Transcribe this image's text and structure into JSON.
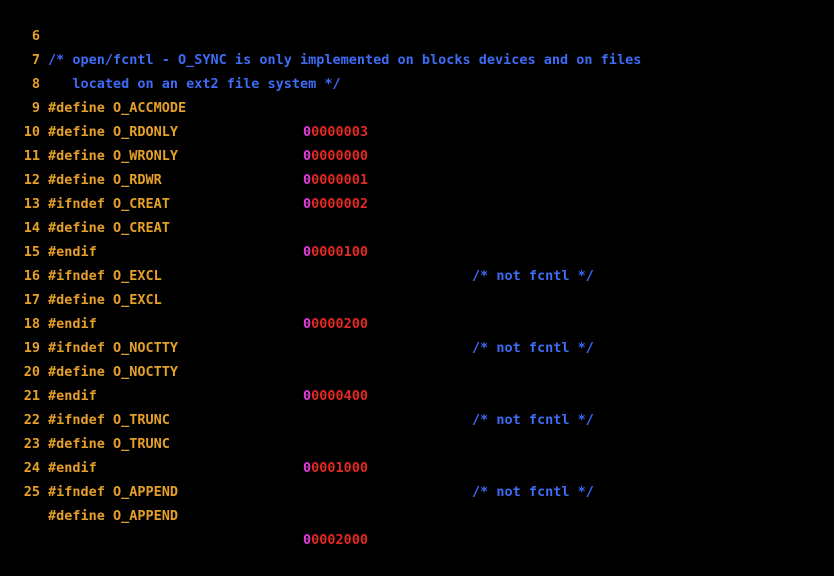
{
  "colors": {
    "background": "#000000",
    "line_number": "#e5a02a",
    "preprocessor": "#e5a02a",
    "comment": "#3f6bf5",
    "octal_prefix": "#e43ae0",
    "number": "#e02a22"
  },
  "lines": [
    {
      "num": "6",
      "text": "/* open/fcntl - O_SYNC is only implemented on blocks devices and on files",
      "kind": "comment"
    },
    {
      "num": "7",
      "text": "   located on an ext2 file system */",
      "kind": "comment"
    },
    {
      "num": "8",
      "text": "#define O_ACCMODE",
      "prefix": "0",
      "value": "0000003",
      "kind": "define"
    },
    {
      "num": "9",
      "text": "#define O_RDONLY",
      "prefix": "0",
      "value": "0000000",
      "kind": "define"
    },
    {
      "num": "10",
      "text": "#define O_WRONLY",
      "prefix": "0",
      "value": "0000001",
      "kind": "define"
    },
    {
      "num": "11",
      "text": "#define O_RDWR",
      "prefix": "0",
      "value": "0000002",
      "kind": "define"
    },
    {
      "num": "12",
      "text": "#ifndef O_CREAT",
      "kind": "pp"
    },
    {
      "num": "13",
      "text": "#define O_CREAT",
      "prefix": "0",
      "value": "0000100",
      "comment": "/* not fcntl */",
      "kind": "define"
    },
    {
      "num": "14",
      "text": "#endif",
      "kind": "pp"
    },
    {
      "num": "15",
      "text": "#ifndef O_EXCL",
      "kind": "pp"
    },
    {
      "num": "16",
      "text": "#define O_EXCL",
      "prefix": "0",
      "value": "0000200",
      "comment": "/* not fcntl */",
      "kind": "define"
    },
    {
      "num": "17",
      "text": "#endif",
      "kind": "pp"
    },
    {
      "num": "18",
      "text": "#ifndef O_NOCTTY",
      "kind": "pp"
    },
    {
      "num": "19",
      "text": "#define O_NOCTTY",
      "prefix": "0",
      "value": "0000400",
      "comment": "/* not fcntl */",
      "kind": "define"
    },
    {
      "num": "20",
      "text": "#endif",
      "kind": "pp"
    },
    {
      "num": "21",
      "text": "#ifndef O_TRUNC",
      "kind": "pp"
    },
    {
      "num": "22",
      "text": "#define O_TRUNC",
      "prefix": "0",
      "value": "0001000",
      "comment": "/* not fcntl */",
      "kind": "define"
    },
    {
      "num": "23",
      "text": "#endif",
      "kind": "pp"
    },
    {
      "num": "24",
      "text": "#ifndef O_APPEND",
      "kind": "pp"
    },
    {
      "num": "25",
      "text": "#define O_APPEND",
      "prefix": "0",
      "value": "0002000",
      "kind": "define"
    }
  ]
}
